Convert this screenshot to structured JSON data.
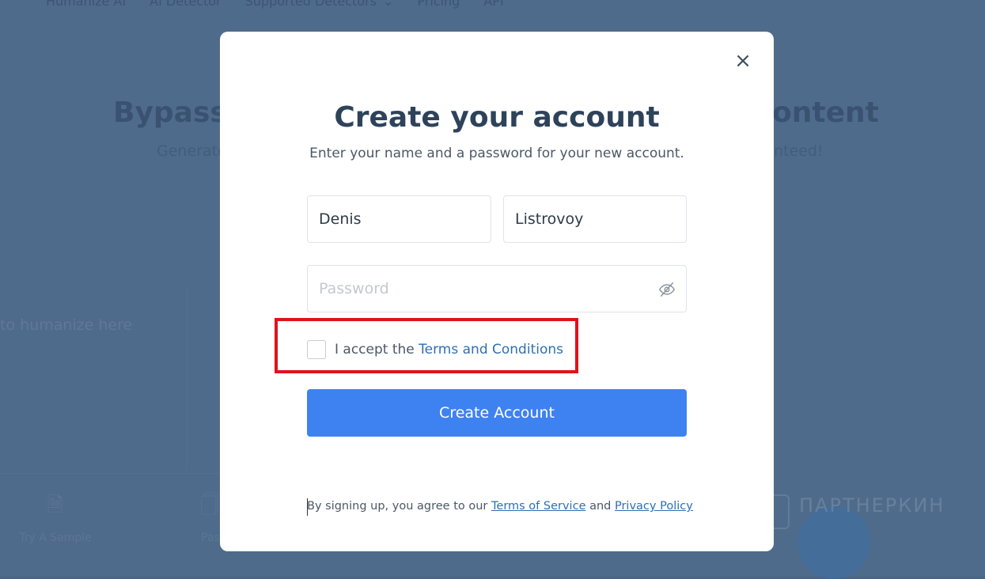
{
  "background": {
    "nav": [
      "Humanize AI",
      "AI Detector",
      "Supported Detectors",
      "Pricing",
      "API"
    ],
    "hero_left": "Bypass",
    "hero_right": "ontent",
    "sub_left": "Generate",
    "sub_right": "nteed!",
    "editor_placeholder": "to humanize here",
    "tool_sample": "Try A Sample",
    "tool_paste": "Pas",
    "watermark": "ПАРТНЕРКИН"
  },
  "modal": {
    "close_symbol": "×",
    "title": "Create your account",
    "subtitle": "Enter your name and a password for your new account.",
    "first_name_value": "Denis",
    "last_name_value": "Listrovoy",
    "password_placeholder": "Password",
    "accept_prefix": "I accept the ",
    "accept_link": "Terms and Conditions",
    "accept_checked": false,
    "create_button": "Create Account",
    "legal_prefix": "By signing up, you agree to our ",
    "legal_terms": "Terms of Service",
    "legal_and": " and ",
    "legal_privacy": "Privacy Policy"
  },
  "colors": {
    "primary": "#3e82f2",
    "highlight": "#e0121d",
    "link": "#2f6fb3"
  }
}
